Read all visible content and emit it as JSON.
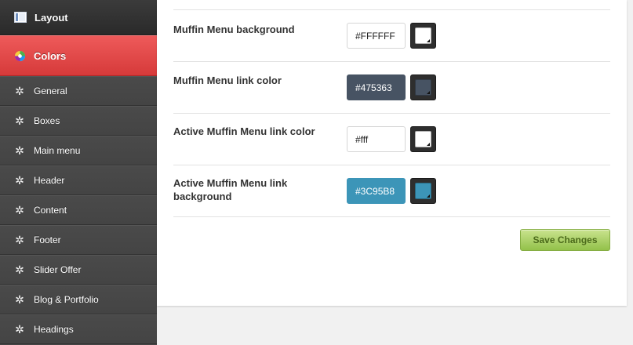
{
  "sidebar": {
    "top": {
      "label": "Layout",
      "icon": "layout-icon"
    },
    "active": {
      "label": "Colors",
      "icon": "color-wheel-icon"
    },
    "items": [
      {
        "label": "General",
        "icon": "gear-icon"
      },
      {
        "label": "Boxes",
        "icon": "gear-icon"
      },
      {
        "label": "Main menu",
        "icon": "gear-icon"
      },
      {
        "label": "Header",
        "icon": "gear-icon"
      },
      {
        "label": "Content",
        "icon": "gear-icon"
      },
      {
        "label": "Footer",
        "icon": "gear-icon"
      },
      {
        "label": "Slider Offer",
        "icon": "gear-icon"
      },
      {
        "label": "Blog & Portfolio",
        "icon": "gear-icon"
      },
      {
        "label": "Headings",
        "icon": "gear-icon"
      }
    ]
  },
  "settings": {
    "rows": [
      {
        "label": "Muffin Menu background",
        "value": "#FFFFFF",
        "color": "#FFFFFF",
        "text_color": "#222222"
      },
      {
        "label": "Muffin Menu link color",
        "value": "#475363",
        "color": "#475363",
        "text_color": "#FFFFFF"
      },
      {
        "label": "Active Muffin Menu link color",
        "value": "#fff",
        "color": "#FFFFFF",
        "text_color": "#222222"
      },
      {
        "label": "Active Muffin Menu link background",
        "value": "#3C95B8",
        "color": "#3C95B8",
        "text_color": "#FFFFFF"
      }
    ]
  },
  "actions": {
    "save_label": "Save Changes"
  },
  "colors": {
    "accent_red": "#E04848",
    "button_green": "#9BC553"
  }
}
